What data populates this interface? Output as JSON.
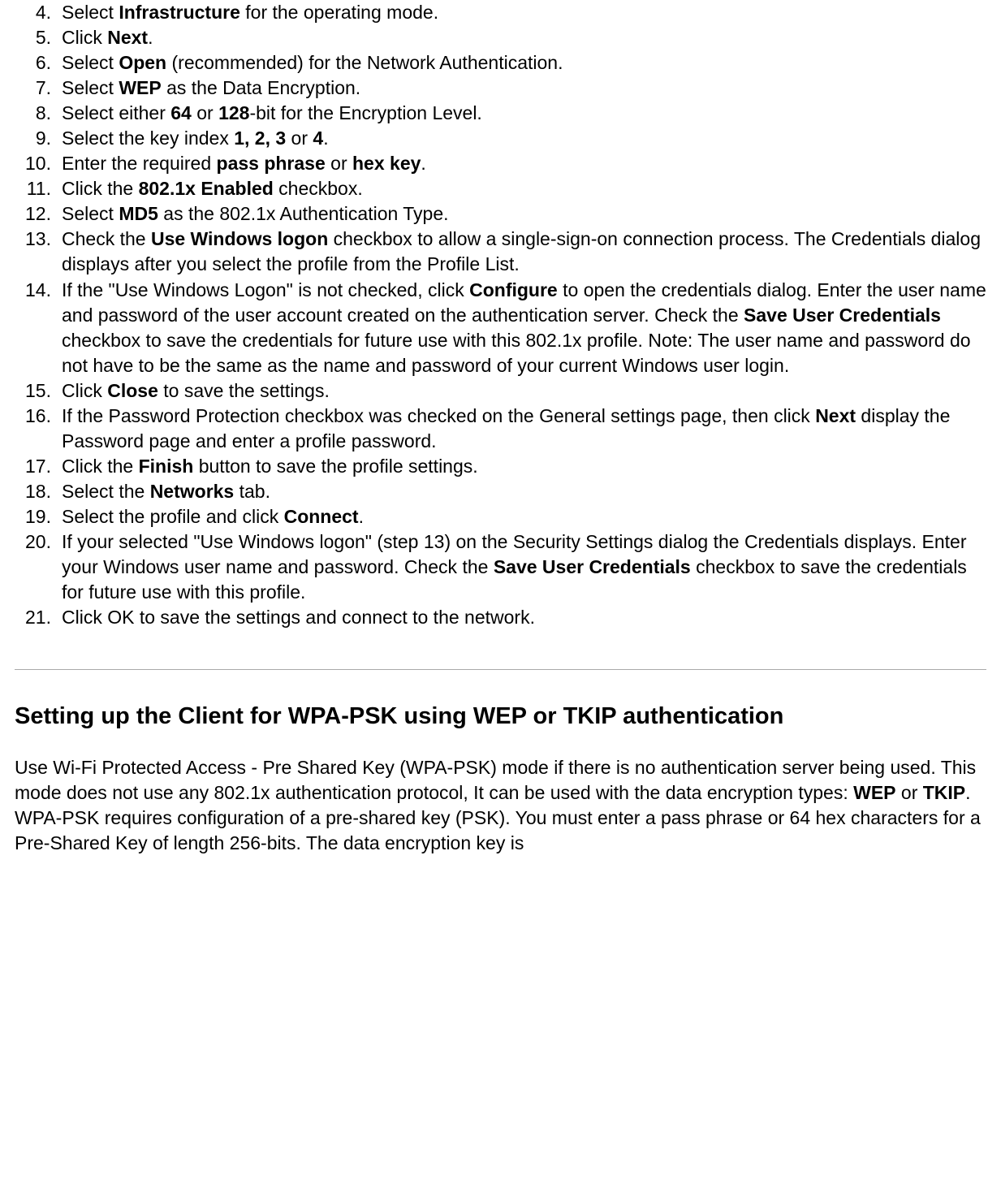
{
  "steps": [
    {
      "pre": "Select ",
      "bold1": "Infrastructure",
      "mid1": " for the operating mode."
    },
    {
      "pre": "Click ",
      "bold1": "Next",
      "mid1": "."
    },
    {
      "pre": "Select ",
      "bold1": "Open",
      "mid1": " (recommended) for the Network Authentication."
    },
    {
      "pre": "Select ",
      "bold1": "WEP",
      "mid1": " as the Data Encryption."
    },
    {
      "pre": "Select either ",
      "bold1": "64",
      "mid1": " or ",
      "bold2": "128",
      "mid2": "-bit for the Encryption Level."
    },
    {
      "pre": "Select the key index ",
      "bold1": "1, 2, 3",
      "mid1": " or ",
      "bold2": "4",
      "mid2": "."
    },
    {
      "pre": "Enter the required ",
      "bold1": "pass phrase",
      "mid1": " or ",
      "bold2": "hex key",
      "mid2": "."
    },
    {
      "pre": "Click the ",
      "bold1": "802.1x Enabled",
      "mid1": " checkbox."
    },
    {
      "pre": "Select ",
      "bold1": "MD5",
      "mid1": " as the 802.1x Authentication Type."
    },
    {
      "pre": "Check the ",
      "bold1": "Use Windows logon",
      "mid1": " checkbox to allow a single-sign-on connection process. The Credentials dialog displays after you select the profile from the Profile List."
    },
    {
      "pre": "If the \"Use Windows Logon\" is not checked, click ",
      "bold1": "Configure",
      "mid1": " to open the credentials dialog. Enter the user name and password of the user account created on the authentication server. Check the ",
      "bold2": "Save User Credentials",
      "mid2": " checkbox to save the credentials for future use with this 802.1x profile. Note: The user name and password do not have to be the same as the name and password of your current Windows user login."
    },
    {
      "pre": "Click ",
      "bold1": "Close",
      "mid1": " to save the settings."
    },
    {
      "pre": "If the Password Protection checkbox was checked on the General settings page, then click ",
      "bold1": "Next",
      "mid1": " display the Password page and enter a profile password."
    },
    {
      "pre": "Click the ",
      "bold1": "Finish",
      "mid1": " button to save the profile settings."
    },
    {
      "pre": "Select the ",
      "bold1": "Networks",
      "mid1": " tab."
    },
    {
      "pre": "Select the profile and click ",
      "bold1": "Connect",
      "mid1": "."
    },
    {
      "pre": "If your selected \"Use Windows logon\" (step 13) on the Security Settings dialog the Credentials displays. Enter your Windows user name and password. Check the ",
      "bold1": "Save User Credentials",
      "mid1": " checkbox to save the credentials for future use with this profile."
    },
    {
      "pre": "Click OK to save the settings and connect to the network."
    }
  ],
  "heading": "Setting up the Client for WPA-PSK using WEP or TKIP authentication",
  "intro": {
    "pre": "Use Wi-Fi Protected Access - Pre Shared Key (WPA-PSK) mode if there is no authentication server being used. This mode does not use any 802.1x authentication protocol, It can be used with the data encryption types: ",
    "b1": "WEP",
    "mid1": " or ",
    "b2": "TKIP",
    "mid2": ". WPA-PSK requires configuration of a pre-shared key (PSK). You must enter a pass phrase or 64 hex characters for a Pre-Shared Key of length 256-bits. The data encryption key is"
  }
}
